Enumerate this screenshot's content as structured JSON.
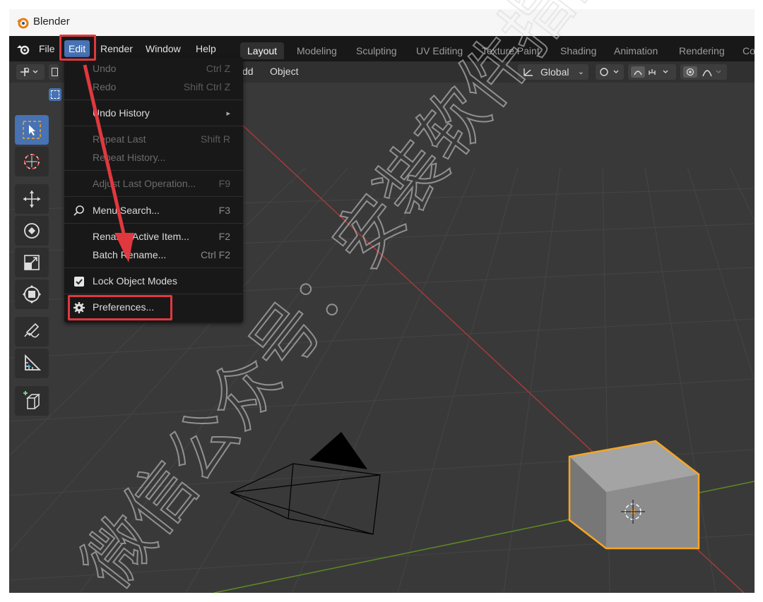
{
  "window": {
    "title": "Blender"
  },
  "menubar": {
    "file": "File",
    "edit": "Edit",
    "render": "Render",
    "window": "Window",
    "help": "Help"
  },
  "workspaces": [
    "Layout",
    "Modeling",
    "Sculpting",
    "UV Editing",
    "Texture Paint",
    "Shading",
    "Animation",
    "Rendering",
    "Co"
  ],
  "header": {
    "add": "Add",
    "add_visible": "dd",
    "object": "Object",
    "orientation": "Global"
  },
  "edit_menu": {
    "undo": {
      "label": "Undo",
      "shortcut": "Ctrl Z"
    },
    "redo": {
      "label": "Redo",
      "shortcut": "Shift Ctrl Z"
    },
    "undo_history": {
      "label": "Undo History",
      "arrow": "▸"
    },
    "repeat_last": {
      "label": "Repeat Last",
      "shortcut": "Shift R"
    },
    "repeat_history": {
      "label": "Repeat History..."
    },
    "adjust_last": {
      "label": "Adjust Last Operation...",
      "shortcut": "F9"
    },
    "menu_search": {
      "label": "Menu Search...",
      "shortcut": "F3"
    },
    "rename_active": {
      "label": "Rename Active Item...",
      "shortcut": "F2"
    },
    "batch_rename": {
      "label": "Batch Rename...",
      "shortcut": "Ctrl F2"
    },
    "lock_object_modes": {
      "label": "Lock Object Modes",
      "checked": true
    },
    "preferences": {
      "label": "Preferences..."
    }
  },
  "watermark": {
    "text": "微信公众号：安装软件指南"
  },
  "colors": {
    "accent": "#4772b3",
    "highlight_red": "#e0383e",
    "selection_orange": "#f5a623",
    "x_axis": "#b33a3a",
    "y_axis": "#6a8e2a"
  },
  "icons": {
    "blender_logo": "blender-logo-icon",
    "search": "search-icon",
    "gear": "gear-icon",
    "checkbox": "checkbox-icon"
  }
}
